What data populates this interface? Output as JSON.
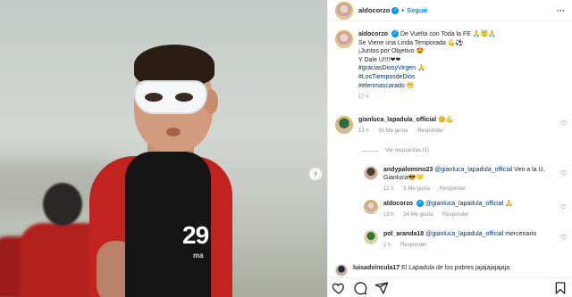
{
  "post": {
    "author": "aldocorzo",
    "follow_label": "Seguir",
    "jersey_number": "29",
    "jersey_brand": "ma",
    "caption_lines": [
      "De Vuelta con Toda la FE 🙏😇🙏",
      "Se Viene una Linda Temporada 💪⚽",
      "¡Juntos por Objetivo 🤩",
      "Y Dale U!!!!❤❤"
    ],
    "hashtags": [
      "#graciasDiosyVirgen 🙏",
      "#LosTiemposdeDios",
      "#elenmascarado 😁"
    ],
    "caption_time": "17 h"
  },
  "comments": {
    "main": {
      "user": "gianluca_lapadula_official",
      "text": "😊💪",
      "time": "13 h",
      "likes": "90 Me gusta",
      "reply_label": "Responder"
    },
    "view_replies": "Ver respuestas (1)",
    "replies": [
      {
        "user": "andypalomino23",
        "mention": "@gianluca_lapadula_official",
        "text": "Ven a la U, Gianluca😎💛",
        "time": "12 h",
        "likes": "5 Me gusta",
        "reply_label": "Responder"
      },
      {
        "user": "aldocorzo",
        "mention": "@gianluca_lapadula_official",
        "text": "🙏",
        "time": "13 h",
        "likes": "24 Me gusta",
        "reply_label": "Responder"
      },
      {
        "user": "pol_aranda18",
        "mention": "@gianluca_lapadula_official",
        "text": "mercenario",
        "time": "2 h",
        "likes": "",
        "reply_label": "Responder"
      }
    ],
    "last": {
      "user": "luisadvincula17",
      "text": "El Lapadula de los pobres jajajajajajaja"
    }
  },
  "icons": {
    "more": "more-horizontal-icon",
    "heart": "heart-icon",
    "comment": "comment-icon",
    "share": "share-icon",
    "bookmark": "bookmark-icon",
    "carousel_next": "chevron-right-icon"
  },
  "colors": {
    "link": "#00376b",
    "accent": "#0095f6",
    "muted": "#8e8e8e"
  }
}
